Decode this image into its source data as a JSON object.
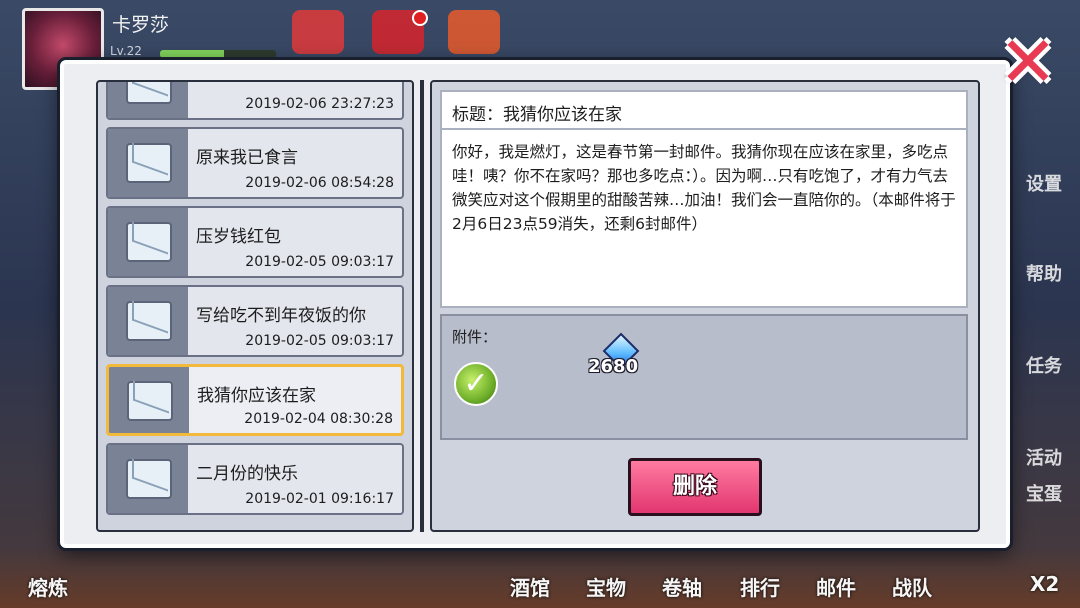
{
  "player": {
    "name": "卡罗莎",
    "level": "Lv.22",
    "xp_fraction": 0.55
  },
  "hud": {
    "side_labels": [
      "设置",
      "帮助",
      "任务",
      "活动",
      "宝蛋"
    ],
    "bottom_menu": [
      "熔炼",
      "酒馆",
      "宝物",
      "卷轴",
      "排行",
      "邮件",
      "战队",
      "X2"
    ]
  },
  "mail_list": [
    {
      "title": "",
      "date": "2019-02-06 23:27:23"
    },
    {
      "title": "原来我已食言",
      "date": "2019-02-06 08:54:28"
    },
    {
      "title": "压岁钱红包",
      "date": "2019-02-05 09:03:17"
    },
    {
      "title": "写给吃不到年夜饭的你",
      "date": "2019-02-05 09:03:17"
    },
    {
      "title": "我猜你应该在家",
      "date": "2019-02-04 08:30:28",
      "selected": true
    },
    {
      "title": "二月份的快乐",
      "date": "2019-02-01 09:16:17"
    }
  ],
  "detail": {
    "subject_label": "标题：我猜你应该在家",
    "body": "你好，我是燃灯，这是春节第一封邮件。我猜你现在应该在家里，多吃点哇！咦？你不在家吗？那也多吃点：）。因为啊…只有吃饱了，才有力气去微笑应对这个假期里的甜酸苦辣…加油！我们会一直陪你的。（本邮件将于2月6日23点59消失，还剩6封邮件）",
    "attachment_label": "附件：",
    "attachment_count": "2680",
    "delete_label": "删除"
  },
  "icons": {
    "close": "close-icon",
    "check": "check-icon",
    "diamond": "diamond-icon",
    "envelope": "envelope-icon"
  },
  "colors": {
    "accent_pink": "#e23670",
    "selected_border": "#f2b93b",
    "close_red": "#e83a52"
  }
}
